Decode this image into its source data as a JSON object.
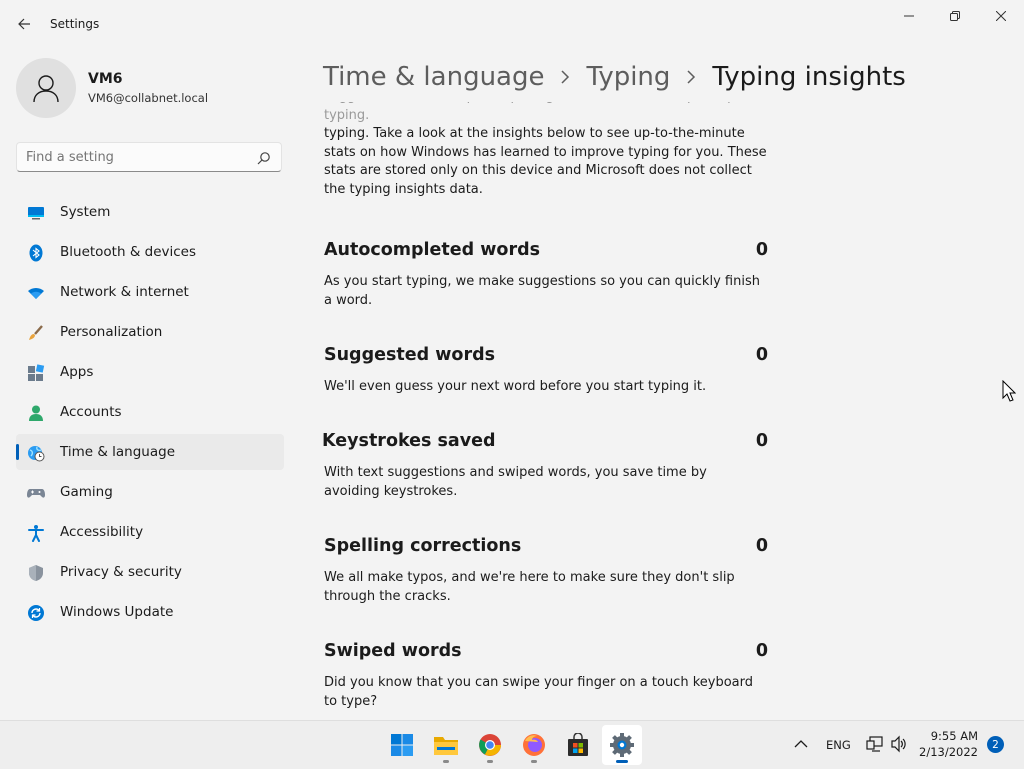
{
  "window": {
    "title": "Settings"
  },
  "user": {
    "name": "VM6",
    "email": "VM6@collabnet.local"
  },
  "search": {
    "placeholder": "Find a setting"
  },
  "sidebar": {
    "items": [
      {
        "label": "System",
        "icon": "system-icon"
      },
      {
        "label": "Bluetooth & devices",
        "icon": "bluetooth-icon"
      },
      {
        "label": "Network & internet",
        "icon": "wifi-icon"
      },
      {
        "label": "Personalization",
        "icon": "brush-icon"
      },
      {
        "label": "Apps",
        "icon": "apps-icon"
      },
      {
        "label": "Accounts",
        "icon": "accounts-icon"
      },
      {
        "label": "Time & language",
        "icon": "globe-clock-icon",
        "selected": true
      },
      {
        "label": "Gaming",
        "icon": "gamepad-icon"
      },
      {
        "label": "Accessibility",
        "icon": "accessibility-icon"
      },
      {
        "label": "Privacy & security",
        "icon": "shield-icon"
      },
      {
        "label": "Windows Update",
        "icon": "update-icon"
      }
    ]
  },
  "breadcrumb": {
    "level1": "Time & language",
    "level2": "Typing",
    "current": "Typing insights"
  },
  "main": {
    "intro_hidden_line": "suggestions, and complete spelling corrections, and help complete typing.",
    "intro_visible": "typing. Take a look at the insights below to see up-to-the-minute stats on how Windows has learned to improve typing for you. These stats are stored only on this device and Microsoft does not collect the typing insights data.",
    "stats": [
      {
        "title": "Autocompleted words",
        "value": "0",
        "description": "As you start typing, we make suggestions so you can quickly finish a word."
      },
      {
        "title": "Suggested words",
        "value": "0",
        "description": "We'll even guess your next word before you start typing it."
      },
      {
        "title": "Keystrokes saved",
        "value": "0",
        "description": "With text suggestions and swiped words, you save time by avoiding keystrokes."
      },
      {
        "title": "Spelling corrections",
        "value": "0",
        "description": "We all make typos, and we're here to make sure they don't slip through the cracks."
      },
      {
        "title": "Swiped words",
        "value": "0",
        "description": "Did you know that you can swipe your finger on a touch keyboard to type?"
      }
    ]
  },
  "taskbar": {
    "apps": [
      {
        "name": "start",
        "icon": "windows-logo-icon"
      },
      {
        "name": "file-explorer",
        "icon": "folder-icon"
      },
      {
        "name": "chrome",
        "icon": "chrome-icon"
      },
      {
        "name": "firefox",
        "icon": "firefox-icon"
      },
      {
        "name": "store",
        "icon": "store-bag-icon"
      },
      {
        "name": "settings",
        "icon": "gear-icon",
        "active": true
      }
    ],
    "tray": {
      "language": "ENG",
      "time": "9:55 AM",
      "date": "2/13/2022",
      "notifications": "2"
    }
  },
  "colors": {
    "accent": "#005fb8",
    "background": "#f3f3f3",
    "selected_nav": "#eaeaea"
  }
}
